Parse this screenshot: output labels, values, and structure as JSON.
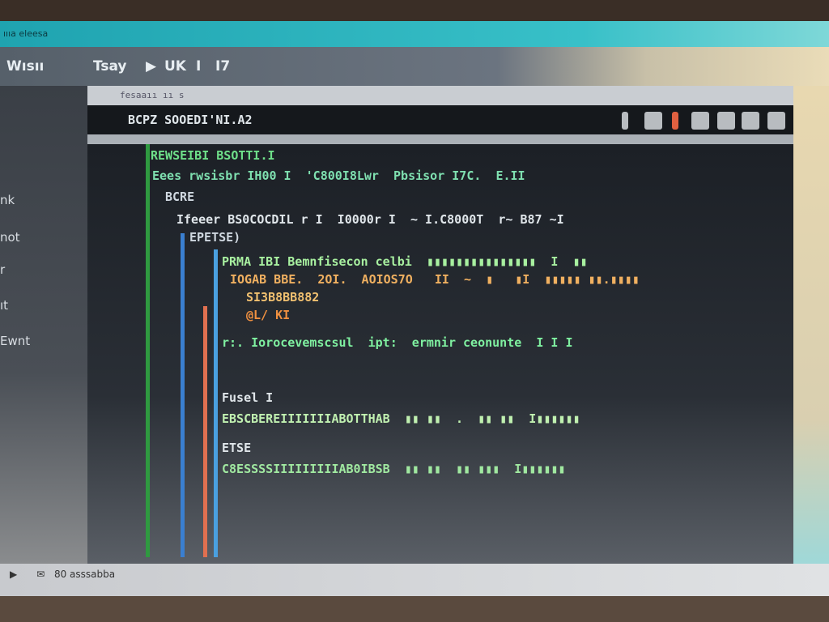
{
  "topbar": {
    "title": "ıııa eleesa"
  },
  "toolbar": {
    "left_label": "Wısıı",
    "menu": "Tsay",
    "play": "▶",
    "item1": "UK",
    "item2": "I",
    "item3": "I7"
  },
  "sidebar": {
    "items": [
      {
        "label": "nk"
      },
      {
        "label": "not"
      },
      {
        "label": "r"
      },
      {
        "label": "ıt"
      },
      {
        "label": "Ewnt"
      }
    ]
  },
  "window": {
    "title": "fesaaıı ıı s",
    "header": "BCPZ SOOEDI'NI.A2"
  },
  "code": {
    "lines": [
      {
        "text": "REWSEIBI BSOTTI.I",
        "color": "#6fe08a"
      },
      {
        "text": "Eees rwsisbr IH00 I  'C800I8Lwr  Pbsisor I7C.  E.II",
        "color": "#7fe0b0"
      },
      {
        "text": "BCRE",
        "color": "#d0d8e0"
      },
      {
        "text": "Ifeeer BS0COCDIL r I  I0000r I  ~ I.C8000T  r~ B87 ~I",
        "color": "#e0e6ea"
      },
      {
        "text": "EPETSE)",
        "color": "#d0d8e0"
      },
      {
        "text": "PRMA IBI Bemnfisecon celbi  ▮▮▮▮▮▮▮▮▮▮▮▮▮▮▮  I  ▮▮",
        "color": "#a8f0a0"
      },
      {
        "text": "IOGAB BBE.  2OI.  AOIOS7O   II  ~  ▮   ▮I  ▮▮▮▮▮ ▮▮.▮▮▮▮",
        "color": "#f0b060"
      },
      {
        "text": "SI3B8BB882",
        "color": "#f0c070"
      },
      {
        "text": "@L/ KI",
        "color": "#f09040"
      },
      {
        "text": "r:. Iorocevemscsul  ipt:  ermnir ceonunte  I I I",
        "color": "#7ff0a0"
      },
      {
        "text": "Fusel I",
        "color": "#e0e6ea"
      },
      {
        "text": "EBSCBEREIIIIIIIABOTTHAB  ▮▮ ▮▮  .  ▮▮ ▮▮  I▮▮▮▮▮▮",
        "color": "#c0f0b0"
      },
      {
        "text": "ETSE",
        "color": "#e0e6ea"
      },
      {
        "text": "C8ESSSSIIIIIIIIIAB0IBSB  ▮▮ ▮▮  ▮▮ ▮▮▮  I▮▮▮▮▮▮",
        "color": "#a0e8a0"
      }
    ]
  },
  "status": {
    "play": "▶",
    "mail": "✉",
    "text": "80 asssabba"
  },
  "colors": {
    "accent": "#1fa3b0",
    "code_bg": "#1c2026"
  }
}
